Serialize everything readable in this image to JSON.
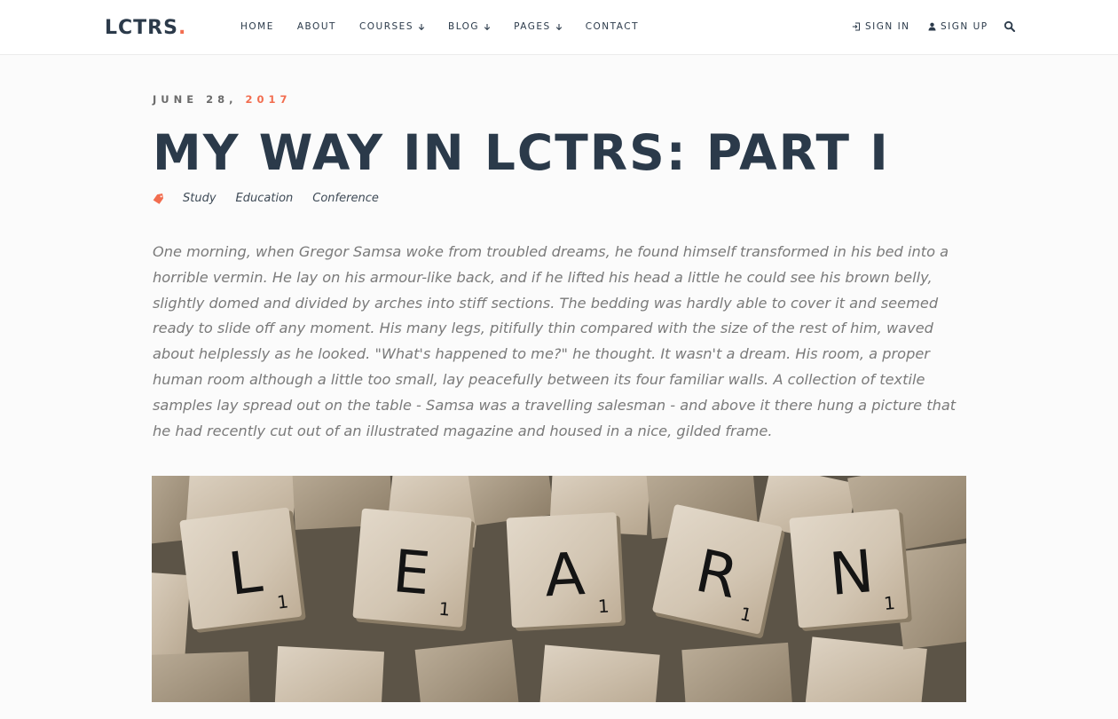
{
  "brand": {
    "name": "LCTRS",
    "dot": ".",
    "accent_color": "#f26d4f",
    "text_color": "#2b3a4a"
  },
  "nav": {
    "items": [
      {
        "label": "HOME",
        "has_dropdown": false
      },
      {
        "label": "ABOUT",
        "has_dropdown": false
      },
      {
        "label": "COURSES",
        "has_dropdown": true
      },
      {
        "label": "BLOG",
        "has_dropdown": true
      },
      {
        "label": "PAGES",
        "has_dropdown": true
      },
      {
        "label": "CONTACT",
        "has_dropdown": false
      }
    ],
    "dropdown_icon": "arrow-down-icon"
  },
  "auth": {
    "sign_in": "SIGN IN",
    "sign_in_icon": "sign-in-icon",
    "sign_up": "SIGN UP",
    "sign_up_icon": "user-icon",
    "search_icon": "search-icon"
  },
  "post": {
    "date_prefix": "JUNE 28,",
    "date_year": "2017",
    "title": "MY WAY IN LCTRS: PART I",
    "tag_icon": "tag-icon",
    "tags": [
      "Study",
      "Education",
      "Conference"
    ],
    "lead": "One morning, when Gregor Samsa woke from troubled dreams, he found himself transformed in his bed into a horrible vermin. He lay on his armour-like back, and if he lifted his head a little he could see his brown belly, slightly domed and divided by arches into stiff sections. The bedding was hardly able to cover it and seemed ready to slide off any moment. His many legs, pitifully thin compared with the size of the rest of him, waved about helplessly as he looked. \"What's happened to me?\" he thought. It wasn't a dream. His room, a proper human room although a little too small, lay peacefully between its four familiar walls. A collection of textile samples lay spread out on the table - Samsa was a travelling salesman - and above it there hung a picture that he had recently cut out of an illustrated magazine and housed in a nice, gilded frame.",
    "hero_tiles": [
      {
        "letter": "L",
        "score": "1"
      },
      {
        "letter": "E",
        "score": "1"
      },
      {
        "letter": "A",
        "score": "1"
      },
      {
        "letter": "R",
        "score": "1"
      },
      {
        "letter": "N",
        "score": "1"
      }
    ]
  }
}
